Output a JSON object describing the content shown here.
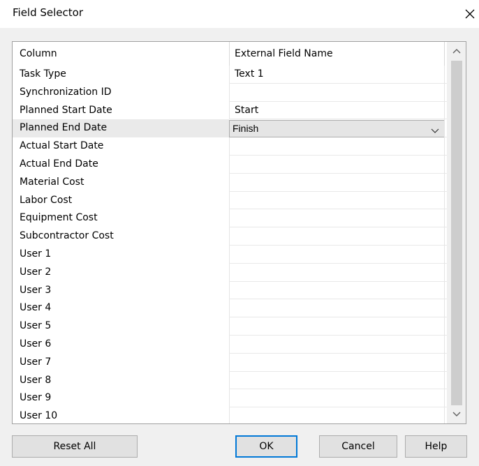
{
  "window": {
    "title": "Field Selector",
    "close_icon": "close-icon"
  },
  "grid": {
    "headers": [
      "Column",
      "External Field Name"
    ],
    "selected_row": 3,
    "rows": [
      {
        "column": "Task Type",
        "field": "Text 1"
      },
      {
        "column": "Synchronization ID",
        "field": ""
      },
      {
        "column": "Planned Start Date",
        "field": "Start"
      },
      {
        "column": "Planned End Date",
        "field": "Finish",
        "editor": "dropdown"
      },
      {
        "column": "Actual Start Date",
        "field": ""
      },
      {
        "column": "Actual End Date",
        "field": ""
      },
      {
        "column": "Material Cost",
        "field": ""
      },
      {
        "column": "Labor Cost",
        "field": ""
      },
      {
        "column": "Equipment Cost",
        "field": ""
      },
      {
        "column": "Subcontractor Cost",
        "field": ""
      },
      {
        "column": "User 1",
        "field": ""
      },
      {
        "column": "User 2",
        "field": ""
      },
      {
        "column": "User 3",
        "field": ""
      },
      {
        "column": "User 4",
        "field": ""
      },
      {
        "column": "User 5",
        "field": ""
      },
      {
        "column": "User 6",
        "field": ""
      },
      {
        "column": "User 7",
        "field": ""
      },
      {
        "column": "User 8",
        "field": ""
      },
      {
        "column": "User 9",
        "field": ""
      },
      {
        "column": "User 10",
        "field": ""
      }
    ]
  },
  "buttons": {
    "reset_all": "Reset All",
    "ok": "OK",
    "cancel": "Cancel",
    "help": "Help"
  },
  "colors": {
    "accent": "#0078d7",
    "dialog_bg": "#f0f0f0",
    "button_bg": "#e1e1e1"
  }
}
